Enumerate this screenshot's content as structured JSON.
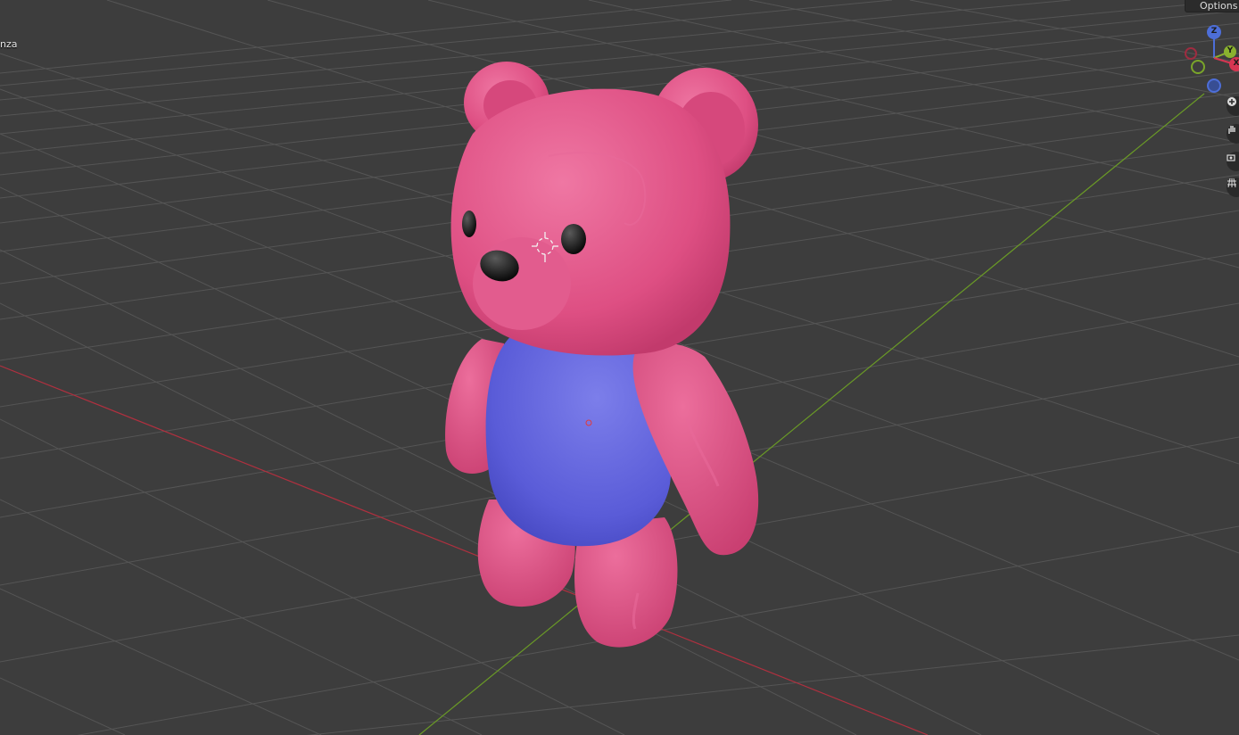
{
  "viewport": {
    "object_name_partial": "nza",
    "options_label": "Options"
  },
  "gizmo": {
    "z_label": "Z",
    "y_label": "Y",
    "x_label": "X"
  },
  "navigation": {
    "zoom_icon": "zoom-icon",
    "pan_icon": "hand-icon",
    "camera_icon": "camera-icon",
    "grid_icon": "perspective-grid-icon"
  },
  "colors": {
    "background": "#3d3d3d",
    "grid": "#555555",
    "x_axis": "#b0303f",
    "y_axis": "#6a9a26",
    "bear_pink": "#de4f83",
    "bear_shirt": "#5a5cd8"
  }
}
